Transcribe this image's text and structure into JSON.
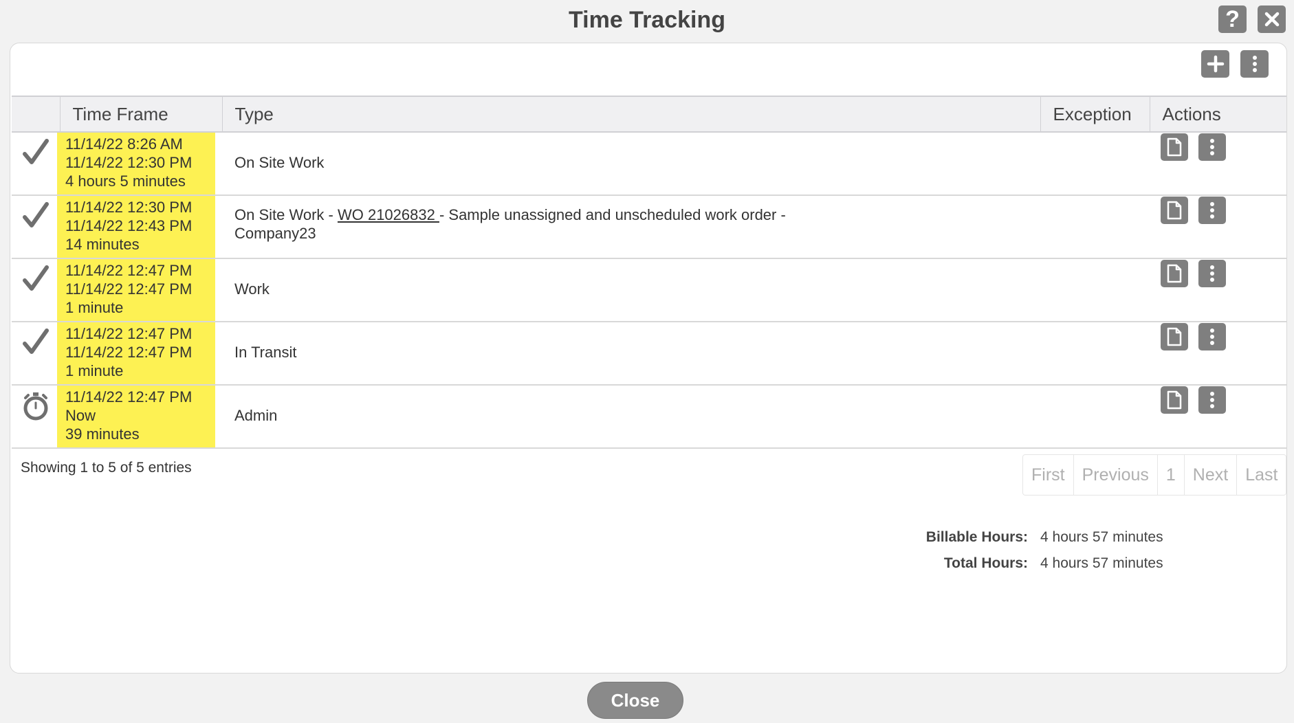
{
  "dialog": {
    "title": "Time Tracking",
    "help_icon": "question-icon",
    "close_icon": "close-icon"
  },
  "toolbar": {
    "add_icon": "plus-icon",
    "more_icon": "vertical-dots-icon"
  },
  "table": {
    "columns": [
      "",
      "Time Frame",
      "Type",
      "Exception",
      "Actions"
    ],
    "rows": [
      {
        "status": "completed",
        "status_icon": "checkmark-icon",
        "start": "11/14/22 8:26 AM",
        "end": "11/14/22 12:30 PM",
        "duration": "4 hours 5 minutes",
        "type_prefix": "On Site Work",
        "type_link": "",
        "type_suffix": "",
        "exception": ""
      },
      {
        "status": "completed",
        "status_icon": "checkmark-icon",
        "start": "11/14/22 12:30 PM",
        "end": "11/14/22 12:43 PM",
        "duration": "14 minutes",
        "type_prefix": "On Site Work - ",
        "type_link": " WO 21026832 ",
        "type_suffix": "- Sample unassigned and unscheduled work order - Company23",
        "exception": ""
      },
      {
        "status": "completed",
        "status_icon": "checkmark-icon",
        "start": "11/14/22 12:47 PM",
        "end": "11/14/22 12:47 PM",
        "duration": "1 minute",
        "type_prefix": "Work",
        "type_link": "",
        "type_suffix": "",
        "exception": ""
      },
      {
        "status": "completed",
        "status_icon": "checkmark-icon",
        "start": "11/14/22 12:47 PM",
        "end": "11/14/22 12:47 PM",
        "duration": "1 minute",
        "type_prefix": "In Transit",
        "type_link": "",
        "type_suffix": "",
        "exception": ""
      },
      {
        "status": "running",
        "status_icon": "stopwatch-icon",
        "start": "11/14/22 12:47 PM",
        "end": "Now",
        "duration": "39 minutes",
        "type_prefix": "Admin",
        "type_link": "",
        "type_suffix": "",
        "exception": ""
      }
    ],
    "row_action_icons": [
      "document-icon",
      "vertical-dots-icon"
    ]
  },
  "footer": {
    "entries_info": "Showing 1 to 5 of 5 entries",
    "pager": [
      "First",
      "Previous",
      "1",
      "Next",
      "Last"
    ]
  },
  "totals": {
    "billable_label": "Billable Hours:",
    "billable_value": "4 hours 57 minutes",
    "total_label": "Total Hours:",
    "total_value": "4 hours 57 minutes"
  },
  "close_label": "Close",
  "colors": {
    "highlight": "#fdf153",
    "button_gray": "#7f7f7f",
    "panel_bg": "#ffffff",
    "page_bg": "#f2f2f2"
  }
}
